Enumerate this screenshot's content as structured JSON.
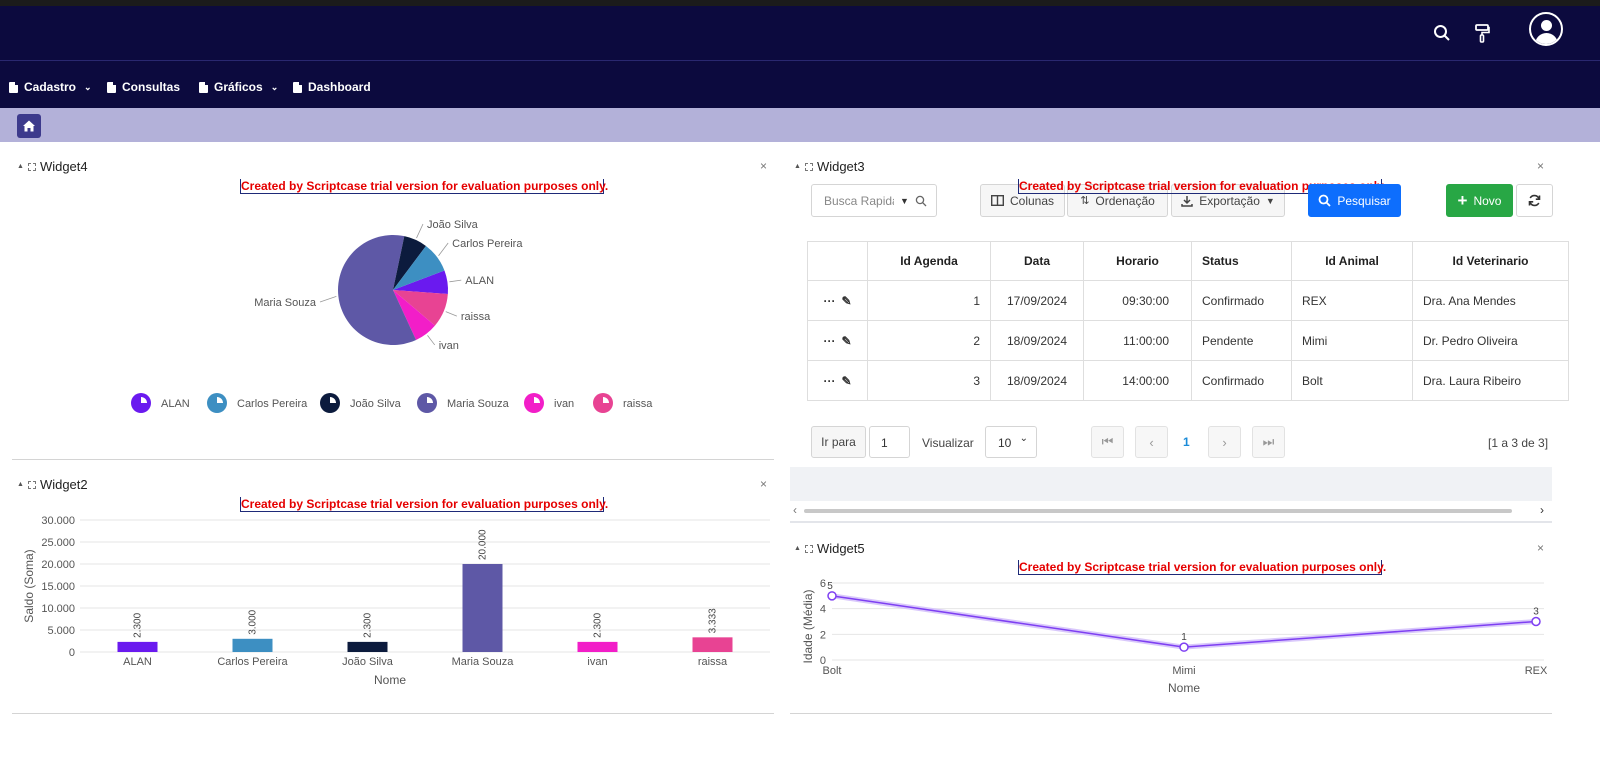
{
  "nav": {
    "items": [
      {
        "label": "Cadastro",
        "dropdown": true
      },
      {
        "label": "Consultas",
        "dropdown": false
      },
      {
        "label": "Gráficos",
        "dropdown": true
      },
      {
        "label": "Dashboard",
        "dropdown": false
      }
    ]
  },
  "header_icons": [
    "search-icon",
    "paint-roller-icon",
    "user-avatar-icon"
  ],
  "trial_notice": "Created by Scriptcase trial version for evaluation purposes only.",
  "widget4": {
    "title": "Widget4",
    "close": "×"
  },
  "widget2": {
    "title": "Widget2",
    "close": "×"
  },
  "widget3": {
    "title": "Widget3",
    "close": "×",
    "search_placeholder": "Busca Rapida",
    "buttons": {
      "columns": "Colunas",
      "sort": "Ordenação",
      "export": "Exportação",
      "search": "Pesquisar",
      "new": "Novo"
    },
    "headers": [
      "Id Agenda",
      "Data",
      "Horario",
      "Status",
      "Id Animal",
      "Id Veterinario"
    ],
    "rows": [
      [
        "1",
        "17/09/2024",
        "09:30:00",
        "Confirmado",
        "REX",
        "Dra. Ana Mendes"
      ],
      [
        "2",
        "18/09/2024",
        "11:00:00",
        "Pendente",
        "Mimi",
        "Dr. Pedro Oliveira"
      ],
      [
        "3",
        "18/09/2024",
        "14:00:00",
        "Confirmado",
        "Bolt",
        "Dra. Laura Ribeiro"
      ]
    ],
    "pager": {
      "goto_label": "Ir para",
      "goto_value": "1",
      "view_label": "Visualizar",
      "view_value": "10",
      "current_page": "1",
      "summary": "[1 a 3 de 3]"
    }
  },
  "widget5": {
    "title": "Widget5",
    "close": "×"
  },
  "colors": {
    "header_bg": "#0c0a3e",
    "tabbar_bg": "#b3b1d9",
    "search_btn": "#0d6efd",
    "new_btn": "#28a745",
    "trial_text": "#e50000"
  },
  "chart_data": [
    {
      "type": "pie",
      "labels": [
        "ALAN",
        "Carlos Pereira",
        "João Silva",
        "Maria Souza",
        "ivan",
        "raissa"
      ],
      "values": [
        2300,
        3000,
        2300,
        20000,
        2300,
        3333
      ],
      "colors": [
        "#6a1aef",
        "#3d8fc2",
        "#0c1b3d",
        "#5e58a6",
        "#f21ec8",
        "#e84393"
      ],
      "legend_position": "bottom"
    },
    {
      "type": "bar",
      "categories": [
        "ALAN",
        "Carlos Pereira",
        "João Silva",
        "Maria Souza",
        "ivan",
        "raissa"
      ],
      "values": [
        2300,
        3000,
        2300,
        20000,
        2300,
        3333
      ],
      "value_labels": [
        "2.300",
        "3.000",
        "2.300",
        "20.000",
        "2.300",
        "3.333"
      ],
      "colors": [
        "#6a1aef",
        "#3d8fc2",
        "#0c1b3d",
        "#5e58a6",
        "#f21ec8",
        "#e84393"
      ],
      "xlabel": "Nome",
      "ylabel": "Saldo (Soma)",
      "ylim": [
        0,
        30000
      ],
      "yticks": [
        "0",
        "5.000",
        "10.000",
        "15.000",
        "20.000",
        "25.000",
        "30.000"
      ],
      "yticks_values": [
        0,
        5000,
        10000,
        15000,
        20000,
        25000,
        30000
      ],
      "grid": true
    },
    {
      "type": "line",
      "categories": [
        "Bolt",
        "Mimi",
        "REX"
      ],
      "values": [
        5,
        1,
        3
      ],
      "value_labels": [
        "5",
        "1",
        "3"
      ],
      "color": "#7e3ff2",
      "xlabel": "Nome",
      "ylabel": "Idade (Média)",
      "ylim": [
        0,
        6
      ],
      "yticks": [
        "0",
        "2",
        "4",
        "6"
      ],
      "yticks_values": [
        0,
        2,
        4,
        6
      ],
      "grid": true
    }
  ]
}
